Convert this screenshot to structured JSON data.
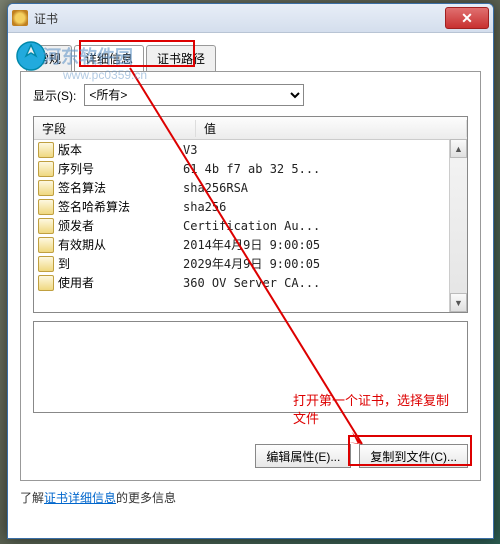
{
  "window": {
    "title": "证书",
    "close": "✕"
  },
  "watermark": {
    "text": "河东软件园",
    "url": "www.pc0359.cn"
  },
  "tabs": {
    "general": "常规",
    "details": "详细信息",
    "certpath": "证书路径"
  },
  "show": {
    "label": "显示(S):",
    "value": "<所有>"
  },
  "columns": {
    "field": "字段",
    "value": "值"
  },
  "rows": [
    {
      "label": "版本",
      "value": "V3"
    },
    {
      "label": "序列号",
      "value": "61 4b f7 ab 32 5..."
    },
    {
      "label": "签名算法",
      "value": "sha256RSA"
    },
    {
      "label": "签名哈希算法",
      "value": "sha256"
    },
    {
      "label": "颁发者",
      "value": "Certification Au..."
    },
    {
      "label": "有效期从",
      "value": "2014年4月9日 9:00:05"
    },
    {
      "label": "到",
      "value": "2029年4月9日 9:00:05"
    },
    {
      "label": "使用者",
      "value": "360 OV Server CA..."
    }
  ],
  "buttons": {
    "editprops": "编辑属性(E)...",
    "copytofile": "复制到文件(C)..."
  },
  "link": {
    "prefix": "了解",
    "text": "证书详细信息",
    "suffix": "的更多信息"
  },
  "annotation": "打开第一个证书，选择复制文件"
}
